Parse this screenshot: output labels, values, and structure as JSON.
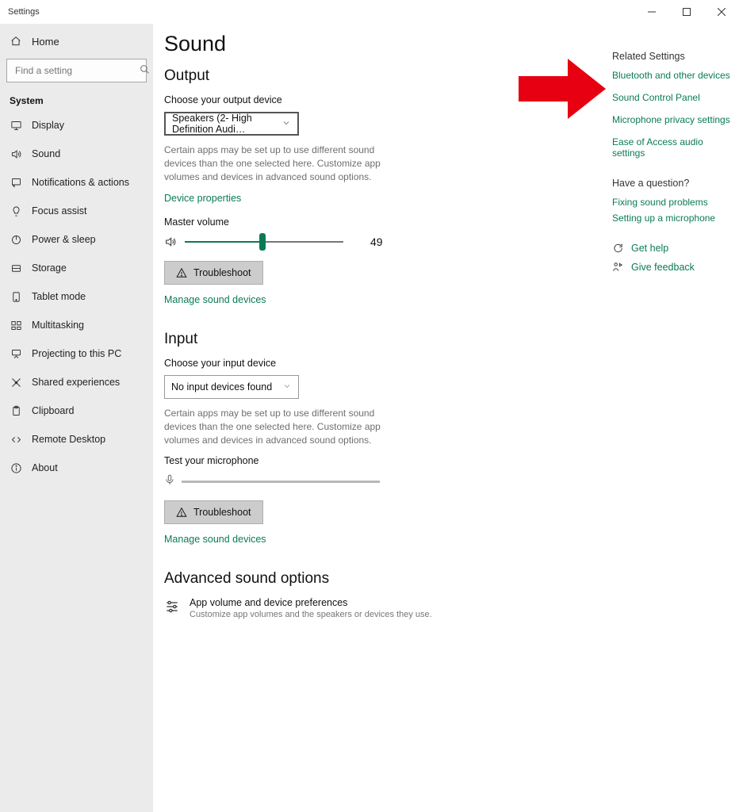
{
  "window": {
    "title": "Settings"
  },
  "sidebar": {
    "home": "Home",
    "search_placeholder": "Find a setting",
    "category": "System",
    "items": [
      {
        "label": "Display",
        "icon": "display"
      },
      {
        "label": "Sound",
        "icon": "sound"
      },
      {
        "label": "Notifications & actions",
        "icon": "notifications"
      },
      {
        "label": "Focus assist",
        "icon": "focus"
      },
      {
        "label": "Power & sleep",
        "icon": "power"
      },
      {
        "label": "Storage",
        "icon": "storage"
      },
      {
        "label": "Tablet mode",
        "icon": "tablet"
      },
      {
        "label": "Multitasking",
        "icon": "multitasking"
      },
      {
        "label": "Projecting to this PC",
        "icon": "projecting"
      },
      {
        "label": "Shared experiences",
        "icon": "shared"
      },
      {
        "label": "Clipboard",
        "icon": "clipboard"
      },
      {
        "label": "Remote Desktop",
        "icon": "remote"
      },
      {
        "label": "About",
        "icon": "about"
      }
    ]
  },
  "page": {
    "title": "Sound",
    "output": {
      "heading": "Output",
      "choose_label": "Choose your output device",
      "device": "Speakers (2- High Definition Audi…",
      "note": "Certain apps may be set up to use different sound devices than the one selected here. Customize app volumes and devices in advanced sound options.",
      "device_properties": "Device properties",
      "master_volume_label": "Master volume",
      "volume": 49,
      "troubleshoot": "Troubleshoot",
      "manage": "Manage sound devices"
    },
    "input": {
      "heading": "Input",
      "choose_label": "Choose your input device",
      "device": "No input devices found",
      "note": "Certain apps may be set up to use different sound devices than the one selected here. Customize app volumes and devices in advanced sound options.",
      "test_label": "Test your microphone",
      "troubleshoot": "Troubleshoot",
      "manage": "Manage sound devices"
    },
    "advanced": {
      "heading": "Advanced sound options",
      "item_title": "App volume and device preferences",
      "item_desc": "Customize app volumes and the speakers or devices they use."
    }
  },
  "right": {
    "related_heading": "Related Settings",
    "links": [
      "Bluetooth and other devices",
      "Sound Control Panel",
      "Microphone privacy settings",
      "Ease of Access audio settings"
    ],
    "question_heading": "Have a question?",
    "question_links": [
      "Fixing sound problems",
      "Setting up a microphone"
    ],
    "help": "Get help",
    "feedback": "Give feedback"
  }
}
